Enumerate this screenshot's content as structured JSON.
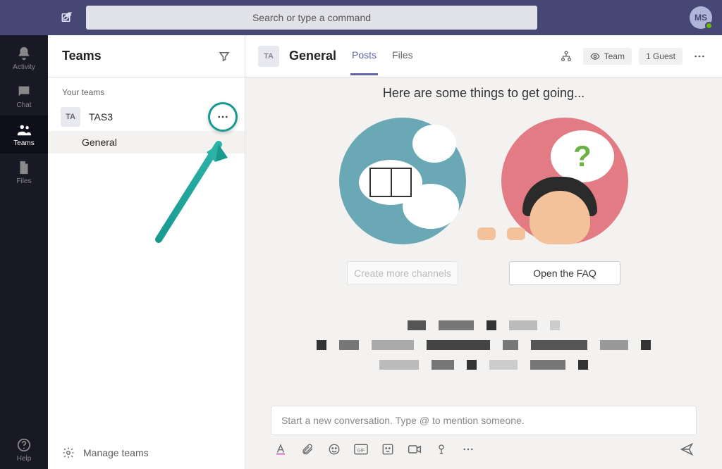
{
  "topbar": {
    "search_placeholder": "Search or type a command",
    "avatar_initials": "MS"
  },
  "rail": {
    "items": [
      {
        "id": "activity",
        "label": "Activity"
      },
      {
        "id": "chat",
        "label": "Chat"
      },
      {
        "id": "teams",
        "label": "Teams"
      },
      {
        "id": "files",
        "label": "Files"
      }
    ],
    "help_label": "Help"
  },
  "panel": {
    "title": "Teams",
    "section_label": "Your teams",
    "team": {
      "avatar": "TA",
      "name": "TAS3"
    },
    "channel": "General",
    "manage_label": "Manage teams"
  },
  "channel_header": {
    "avatar": "TA",
    "title": "General",
    "tabs": [
      "Posts",
      "Files"
    ],
    "visibility_label": "Team",
    "guest_label": "1 Guest"
  },
  "welcome": {
    "title": "Here are some things to get going...",
    "create_channels_label": "Create more channels",
    "open_faq_label": "Open the FAQ"
  },
  "composer": {
    "placeholder": "Start a new conversation. Type @ to mention someone."
  },
  "colors": {
    "teal": "#199a90",
    "pink": "#e37b85",
    "purple": "#464775"
  }
}
